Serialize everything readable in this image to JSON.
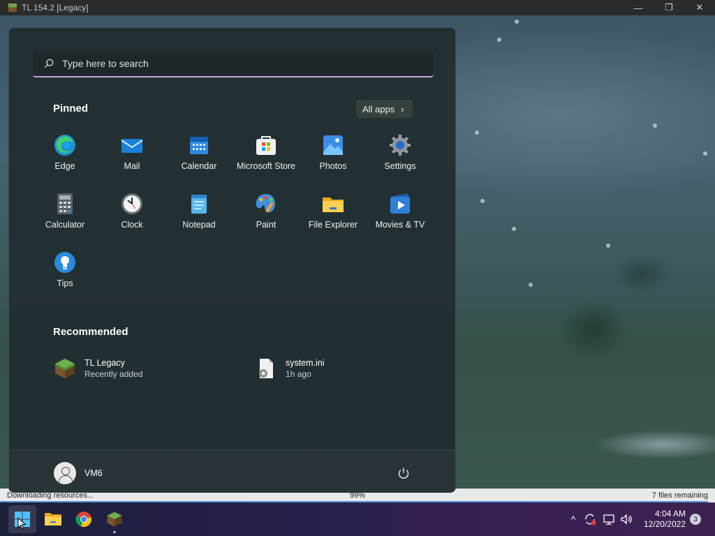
{
  "window": {
    "title": "TL 154.2 [Legacy]",
    "minimize_glyph": "—",
    "maximize_glyph": "❐",
    "close_glyph": "✕"
  },
  "launcher": {
    "status_left": "Downloading resources...",
    "progress_text": "99%",
    "progress_value": 0.99,
    "status_right": "7 files remaining"
  },
  "start_menu": {
    "search_placeholder": "Type here to search",
    "pinned_label": "Pinned",
    "all_apps_label": "All apps",
    "all_apps_chevron": "›",
    "pinned": [
      {
        "label": "Edge",
        "icon": "edge-icon"
      },
      {
        "label": "Mail",
        "icon": "mail-icon"
      },
      {
        "label": "Calendar",
        "icon": "calendar-icon"
      },
      {
        "label": "Microsoft Store",
        "icon": "store-icon"
      },
      {
        "label": "Photos",
        "icon": "photos-icon"
      },
      {
        "label": "Settings",
        "icon": "gear-icon"
      },
      {
        "label": "Calculator",
        "icon": "calculator-icon"
      },
      {
        "label": "Clock",
        "icon": "clock-icon"
      },
      {
        "label": "Notepad",
        "icon": "notepad-icon"
      },
      {
        "label": "Paint",
        "icon": "paint-palette-icon"
      },
      {
        "label": "File Explorer",
        "icon": "folder-icon"
      },
      {
        "label": "Movies & TV",
        "icon": "play-icon"
      },
      {
        "label": "Tips",
        "icon": "lightbulb-icon"
      }
    ],
    "recommended_label": "Recommended",
    "recommended": [
      {
        "name": "TL Legacy",
        "sub": "Recently added",
        "icon": "grass-block-icon"
      },
      {
        "name": "system.ini",
        "sub": "1h ago",
        "icon": "settings-file-icon"
      }
    ],
    "user_name": "VM6",
    "power_icon": "power-icon"
  },
  "taskbar": {
    "apps": [
      "windows-start-icon",
      "folder-icon",
      "chrome-icon",
      "grass-block-icon"
    ],
    "tray_chevron": "^",
    "time": "4:04 AM",
    "date": "12/20/2022",
    "notification_count": "3"
  },
  "colors": {
    "accent_underline": "#c9a0dc",
    "start_bg": "#222e32",
    "taskbar_start": "#1c1f3a",
    "taskbar_end": "#3d2250"
  }
}
